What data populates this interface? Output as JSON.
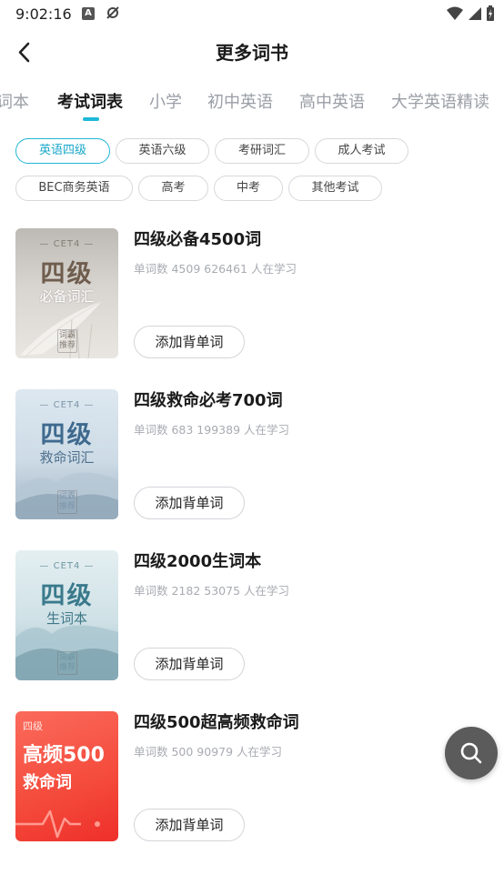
{
  "status_bar": {
    "time": "9:02:16",
    "icons": [
      "notification-a-icon",
      "no-sync-icon",
      "wifi-icon",
      "signal-icon",
      "battery-charging-icon"
    ]
  },
  "header": {
    "title": "更多词书",
    "back_icon": "back-arrow-icon"
  },
  "tabs": [
    {
      "label": "词本",
      "active": false
    },
    {
      "label": "考试词表",
      "active": true
    },
    {
      "label": "小学",
      "active": false
    },
    {
      "label": "初中英语",
      "active": false
    },
    {
      "label": "高中英语",
      "active": false
    },
    {
      "label": "大学英语精读",
      "active": false
    }
  ],
  "chips": [
    {
      "label": "英语四级",
      "active": true
    },
    {
      "label": "英语六级",
      "active": false
    },
    {
      "label": "考研词汇",
      "active": false
    },
    {
      "label": "成人考试",
      "active": false
    },
    {
      "label": "BEC商务英语",
      "active": false
    },
    {
      "label": "高考",
      "active": false
    },
    {
      "label": "中考",
      "active": false
    },
    {
      "label": "其他考试",
      "active": false
    }
  ],
  "books": [
    {
      "title": "四级必备4500词",
      "meta": "单词数 4509  626461 人在学习",
      "button": "添加背单词",
      "cover": {
        "tag": "— CET4 —",
        "big": "四级",
        "sub": "必备词汇",
        "stamp": "词霸推荐"
      }
    },
    {
      "title": "四级救命必考700词",
      "meta": "单词数 683  199389 人在学习",
      "button": "添加背单词",
      "cover": {
        "tag": "— CET4 —",
        "big": "四级",
        "sub": "救命词汇",
        "stamp": "词霸推荐"
      }
    },
    {
      "title": "四级2000生词本",
      "meta": "单词数 2182  53075 人在学习",
      "button": "添加背单词",
      "cover": {
        "tag": "— CET4 —",
        "big": "四级",
        "sub": "生词本",
        "stamp": "词霸推荐"
      }
    },
    {
      "title": "四级500超高频救命词",
      "meta": "单词数 500  90979 人在学习",
      "button": "添加背单词",
      "cover": {
        "small": "四级",
        "big": "高频500",
        "sub": "救命词"
      }
    }
  ],
  "fab": {
    "icon": "search-icon"
  },
  "colors": {
    "accent": "#1fb8d8",
    "cover_red": "#f44a3b",
    "fab": "#5b5b5b"
  }
}
